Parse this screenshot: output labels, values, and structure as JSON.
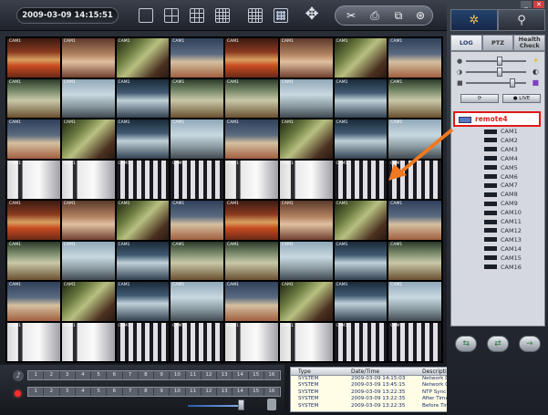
{
  "toolbar": {
    "datetime": "2009-03-09 14:15:51",
    "layouts": [
      "single",
      "grid-2x2",
      "grid-3x3",
      "grid-4x4",
      "grid-5x5",
      "grid-8x8"
    ],
    "active_layout": "grid-8x8",
    "move_icon": "✥",
    "tools": [
      "✂",
      "⎙",
      "⧉",
      "⊛"
    ]
  },
  "grid": {
    "label": "CAM1"
  },
  "timeline": {
    "numbers": [
      "1",
      "2",
      "3",
      "4",
      "5",
      "6",
      "7",
      "8",
      "9",
      "10",
      "11",
      "12",
      "13",
      "14",
      "15",
      "16"
    ]
  },
  "log": {
    "headers": {
      "type": "Type",
      "datetime": "Date/Time",
      "description": "Description"
    },
    "rows": [
      {
        "type": "SYSTEM",
        "datetime": "2009-03-09 14:15:03",
        "description": "Network Disconnected"
      },
      {
        "type": "SYSTEM",
        "datetime": "2009-03-09 13:45:15",
        "description": "Network Connected"
      },
      {
        "type": "SYSTEM",
        "datetime": "2009-03-09 13:22:35",
        "description": "NTP Sync : Success"
      },
      {
        "type": "SYSTEM",
        "datetime": "2009-03-09 13:22:35",
        "description": "After Time Adjusted"
      },
      {
        "type": "SYSTEM",
        "datetime": "2009-03-09 13:22:35",
        "description": "Before Time Adjusted"
      }
    ]
  },
  "right_panel": {
    "tabs": {
      "settings_icon": "gear-icon",
      "search_icon": "search-icon"
    },
    "sub_tabs": [
      {
        "label": "LOG",
        "active": true
      },
      {
        "label": "PTZ",
        "active": false
      },
      {
        "label": "Health Check",
        "active": false
      }
    ],
    "action_buttons": [
      "⟳",
      "● LIVE"
    ],
    "tree": {
      "root": "remote4",
      "cameras": [
        "CAM1",
        "CAM2",
        "CAM3",
        "CAM4",
        "CAM5",
        "CAM6",
        "CAM7",
        "CAM8",
        "CAM9",
        "CAM10",
        "CAM11",
        "CAM12",
        "CAM13",
        "CAM14",
        "CAM15",
        "CAM16"
      ]
    },
    "footer_buttons": [
      "⇆",
      "⇄",
      "→"
    ]
  },
  "colors": {
    "highlight": "#e01818",
    "arrow": "#f07820",
    "accent": "#23426c"
  }
}
